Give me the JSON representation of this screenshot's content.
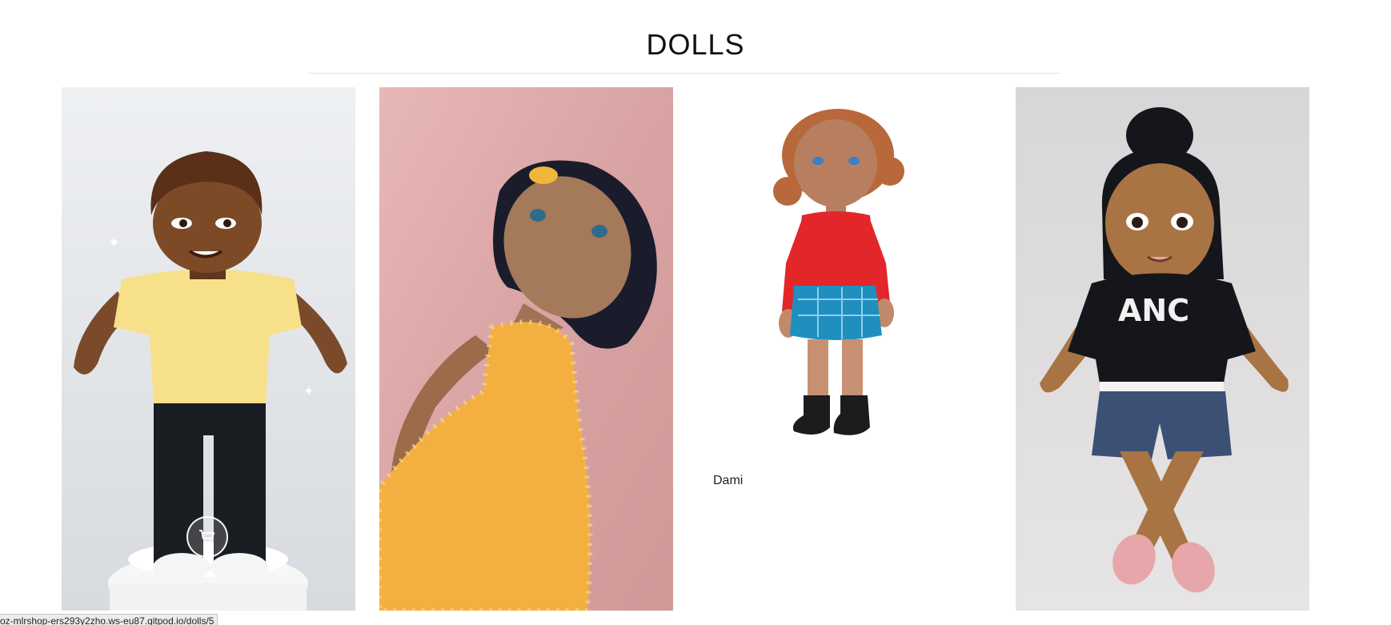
{
  "section": {
    "title": "DOLLS"
  },
  "products": [
    {
      "name": "",
      "image_icon": "doll-yellow-shirt-image"
    },
    {
      "name": "",
      "image_icon": "doll-orange-dress-image"
    },
    {
      "name": "Dami",
      "image_icon": "doll-red-top-blue-skirt-image"
    },
    {
      "name": "",
      "image_icon": "doll-black-hoodie-image"
    }
  ],
  "cart_button": {
    "icon": "shopping-cart-icon"
  },
  "status_bar": {
    "url": "oz-mlrshop-ers293y2zho.ws-eu87.gitpod.io/dolls/5"
  }
}
